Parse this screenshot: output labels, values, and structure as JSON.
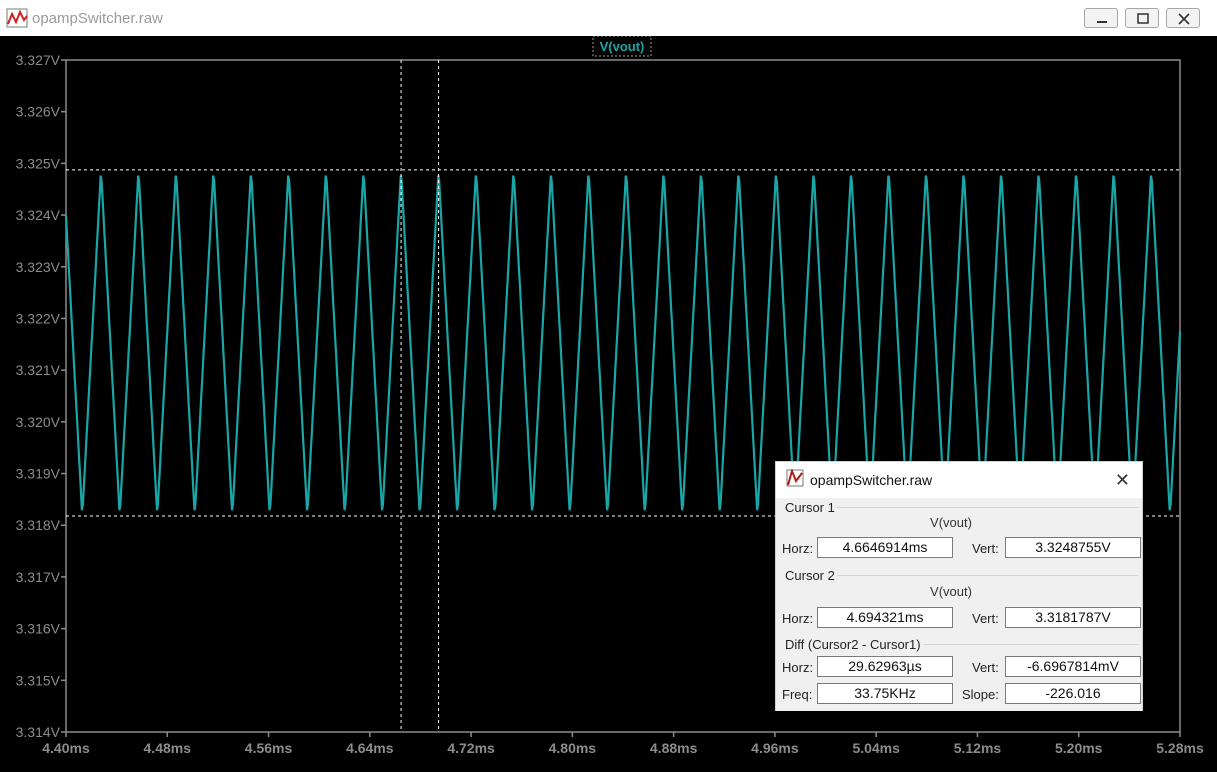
{
  "window": {
    "title": "opampSwitcher.raw",
    "buttons": [
      "minimize",
      "maximize",
      "close"
    ]
  },
  "plot": {
    "trace_name": "V(vout)",
    "background": "#000000",
    "trace_color": "#1aa6a6",
    "grid_color": "#8c8c8c",
    "cursor_color": "#ffffff"
  },
  "chart_data": {
    "type": "line",
    "series": [
      {
        "name": "V(vout)",
        "waveform": "sawtooth",
        "frequency_khz": 33.75,
        "min_v": 3.3181787,
        "max_v": 3.3248755
      }
    ],
    "x_range_ms": [
      4.4,
      5.28
    ],
    "y_range_v": [
      3.314,
      3.327
    ],
    "x_ticks": [
      "4.40ms",
      "4.48ms",
      "4.56ms",
      "4.64ms",
      "4.72ms",
      "4.80ms",
      "4.88ms",
      "4.96ms",
      "5.04ms",
      "5.12ms",
      "5.20ms",
      "5.28ms"
    ],
    "x_tick_values": [
      4.4,
      4.48,
      4.56,
      4.64,
      4.72,
      4.8,
      4.88,
      4.96,
      5.04,
      5.12,
      5.2,
      5.28
    ],
    "y_ticks": [
      "3.327V",
      "3.326V",
      "3.325V",
      "3.324V",
      "3.323V",
      "3.322V",
      "3.321V",
      "3.320V",
      "3.319V",
      "3.318V",
      "3.317V",
      "3.316V",
      "3.315V",
      "3.314V"
    ],
    "y_tick_values": [
      3.327,
      3.326,
      3.325,
      3.324,
      3.323,
      3.322,
      3.321,
      3.32,
      3.319,
      3.318,
      3.317,
      3.316,
      3.315,
      3.314
    ],
    "cursor1": {
      "x_ms": 4.6646914,
      "y_v": 3.3248755
    },
    "cursor2": {
      "x_ms": 4.694321,
      "y_v": 3.3181787
    }
  },
  "cursor_dialog": {
    "title": "opampSwitcher.raw",
    "close": "✕",
    "cursor1": {
      "group": "Cursor 1",
      "trace": "V(vout)",
      "horz_label": "Horz:",
      "horz": "4.6646914ms",
      "vert_label": "Vert:",
      "vert": "3.3248755V"
    },
    "cursor2": {
      "group": "Cursor 2",
      "trace": "V(vout)",
      "horz_label": "Horz:",
      "horz": "4.694321ms",
      "vert_label": "Vert:",
      "vert": "3.3181787V"
    },
    "diff": {
      "group": "Diff (Cursor2 - Cursor1)",
      "horz_label": "Horz:",
      "horz": "29.62963µs",
      "vert_label": "Vert:",
      "vert": "-6.6967814mV",
      "freq_label": "Freq:",
      "freq": "33.75KHz",
      "slope_label": "Slope:",
      "slope": "-226.016"
    }
  }
}
